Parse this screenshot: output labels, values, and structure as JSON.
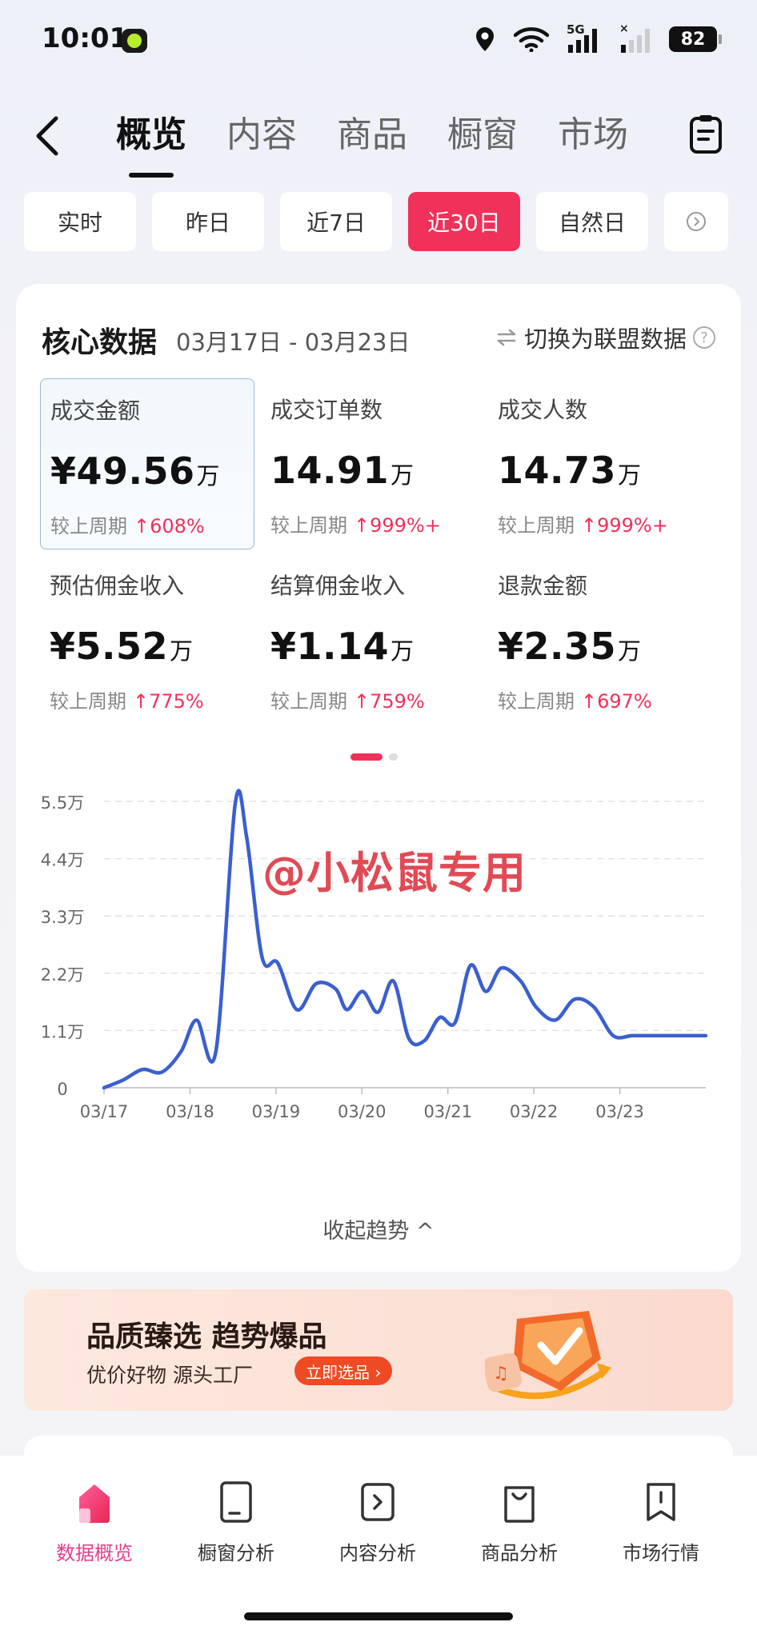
{
  "status_bar": {
    "time": "10:01",
    "network": "5G",
    "battery": "82"
  },
  "nav": {
    "tabs": [
      {
        "label": "概览",
        "active": true
      },
      {
        "label": "内容",
        "active": false
      },
      {
        "label": "商品",
        "active": false
      },
      {
        "label": "橱窗",
        "active": false
      },
      {
        "label": "市场",
        "active": false
      }
    ]
  },
  "date_filter": {
    "options": [
      "实时",
      "昨日",
      "近7日",
      "近30日",
      "自然日"
    ],
    "active": "近30日"
  },
  "core": {
    "title": "核心数据",
    "range": "03月17日 - 03月23日",
    "switch_label": "切换为联盟数据",
    "help": "?",
    "metrics": [
      {
        "label": "成交金额",
        "value": "¥49.56",
        "unit": "万",
        "compare_label": "较上周期",
        "change": "↑608%"
      },
      {
        "label": "成交订单数",
        "value": "14.91",
        "unit": "万",
        "compare_label": "较上周期",
        "change": "↑999%+"
      },
      {
        "label": "成交人数",
        "value": "14.73",
        "unit": "万",
        "compare_label": "较上周期",
        "change": "↑999%+"
      },
      {
        "label": "预估佣金收入",
        "value": "¥5.52",
        "unit": "万",
        "compare_label": "较上周期",
        "change": "↑775%"
      },
      {
        "label": "结算佣金收入",
        "value": "¥1.14",
        "unit": "万",
        "compare_label": "较上周期",
        "change": "↑759%"
      },
      {
        "label": "退款金额",
        "value": "¥2.35",
        "unit": "万",
        "compare_label": "较上周期",
        "change": "↑697%"
      }
    ],
    "collapse_label": "收起趋势 ^"
  },
  "watermark": "@小松鼠专用",
  "chart_data": {
    "type": "line",
    "title": "",
    "xlabel": "",
    "ylabel": "",
    "yticks": [
      "0",
      "1.1万",
      "2.2万",
      "3.3万",
      "4.4万",
      "5.5万"
    ],
    "ylim": [
      0,
      5.5
    ],
    "xticks": [
      "03/17",
      "03/18",
      "03/19",
      "03/20",
      "03/21",
      "03/22",
      "03/23"
    ],
    "color": "#3b5fcf",
    "series": [
      {
        "unit": "万",
        "x": [
          0,
          0.25,
          0.5,
          0.75,
          1.0,
          1.2,
          1.45,
          1.7,
          1.85,
          2.05,
          2.25,
          2.5,
          2.75,
          3.0,
          3.15,
          3.35,
          3.55,
          3.75,
          3.95,
          4.15,
          4.35,
          4.55,
          4.75,
          4.95,
          5.15,
          5.4,
          5.6,
          5.85,
          6.1,
          6.35,
          6.6,
          6.85,
          7.1,
          7.35,
          7.6,
          7.8
        ],
        "y": [
          0.0,
          0.15,
          0.35,
          0.3,
          0.7,
          1.3,
          0.7,
          5.45,
          4.8,
          2.5,
          2.4,
          1.5,
          2.0,
          1.9,
          1.5,
          1.85,
          1.45,
          2.05,
          0.95,
          0.9,
          1.35,
          1.25,
          2.35,
          1.85,
          2.3,
          2.05,
          1.55,
          1.3,
          1.7,
          1.55,
          1.0,
          1.0,
          1.0,
          1.0,
          1.0,
          1.0
        ]
      }
    ]
  },
  "banner": {
    "title": "品质臻选 趋势爆品",
    "sub": "优价好物  源头工厂",
    "cta": "立即选品 ›"
  },
  "bottom_nav": [
    {
      "label": "数据概览",
      "active": true
    },
    {
      "label": "橱窗分析",
      "active": false
    },
    {
      "label": "内容分析",
      "active": false
    },
    {
      "label": "商品分析",
      "active": false
    },
    {
      "label": "市场行情",
      "active": false
    }
  ]
}
